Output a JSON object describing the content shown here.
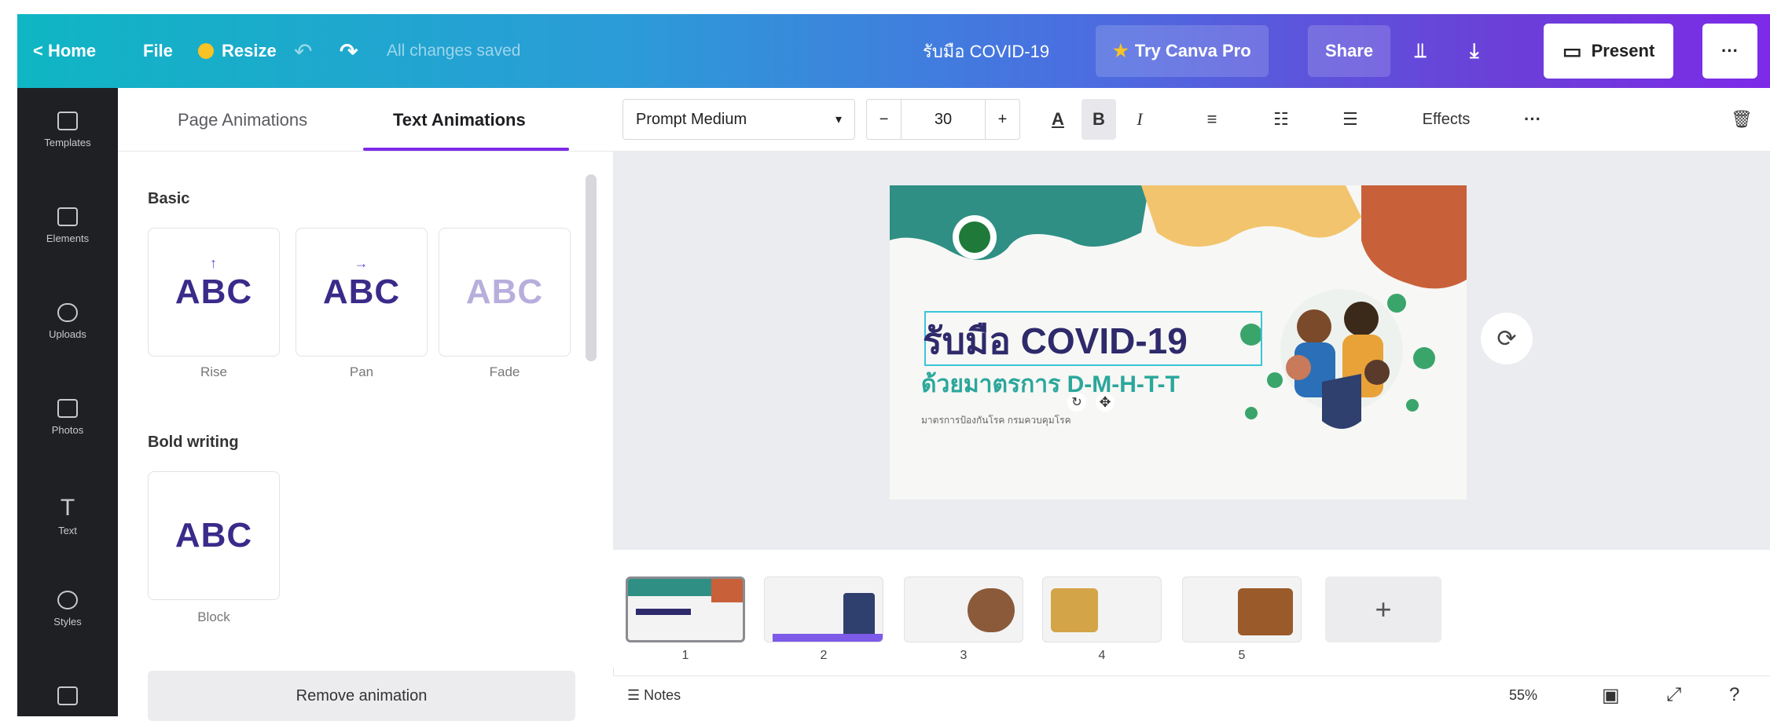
{
  "topbar": {
    "home_label": "< Home",
    "file_label": "File",
    "resize_label": "Resize",
    "saved_status": "All changes saved",
    "doc_title": "รับมือ COVID-19",
    "try_pro_label": "Try Canva Pro",
    "share_label": "Share",
    "present_label": "Present",
    "more_label": "···"
  },
  "sidebar": {
    "items": [
      {
        "label": "Templates",
        "icon": "templates-icon"
      },
      {
        "label": "Elements",
        "icon": "elements-icon"
      },
      {
        "label": "Uploads",
        "icon": "uploads-icon"
      },
      {
        "label": "Photos",
        "icon": "photos-icon"
      },
      {
        "label": "Text",
        "icon": "text-icon"
      },
      {
        "label": "Styles",
        "icon": "styles-icon"
      },
      {
        "label": "",
        "icon": "folder-icon"
      }
    ]
  },
  "panel": {
    "tabs": [
      "Page Animations",
      "Text Animations"
    ],
    "active_tab": "Text Animations",
    "basic_title": "Basic",
    "basic_items": [
      {
        "label": "Rise",
        "sample": "ABC"
      },
      {
        "label": "Pan",
        "sample": "ABC"
      },
      {
        "label": "Fade",
        "sample": "ABC"
      }
    ],
    "bold_title": "Bold writing",
    "bold_items": [
      {
        "label": "Block",
        "sample": "ABC"
      }
    ],
    "remove_label": "Remove animation"
  },
  "toolbar": {
    "font_name": "Prompt Medium",
    "font_size": "30",
    "minus": "−",
    "plus": "+",
    "bold": "B",
    "italic": "I",
    "effects_label": "Effects",
    "more_label": "···"
  },
  "canvas": {
    "headline": "รับมือ COVID-19",
    "subheadline": "ด้วยมาตรการ D-M-H-T-T",
    "small_text": "มาตรการป้องกันโรค กรมควบคุมโรค"
  },
  "pages": {
    "numbers": [
      "1",
      "2",
      "3",
      "4",
      "5"
    ],
    "selected": "1",
    "add_label": "+"
  },
  "footer": {
    "notes_label": "Notes",
    "zoom": "55%"
  },
  "colors": {
    "accent": "#7d2ae8",
    "headline": "#2e2a6b",
    "teal": "#2aa79b"
  }
}
